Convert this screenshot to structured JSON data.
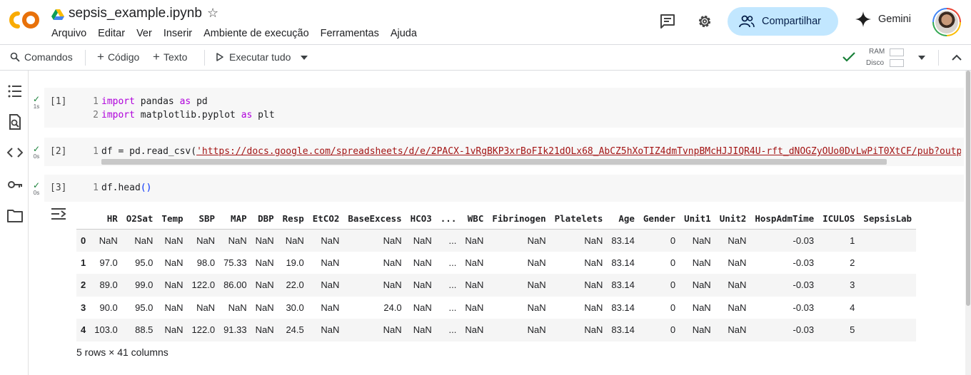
{
  "app": {
    "notebook_title": "sepsis_example.ipynb",
    "menu": [
      "Arquivo",
      "Editar",
      "Ver",
      "Inserir",
      "Ambiente de execução",
      "Ferramentas",
      "Ajuda"
    ],
    "share_label": "Compartilhar",
    "gemini_label": "Gemini"
  },
  "toolbar": {
    "commands_label": "Comandos",
    "code_label": "Código",
    "text_label": "Texto",
    "run_all_label": "Executar tudo",
    "ram_label": "RAM",
    "disk_label": "Disco"
  },
  "cells": [
    {
      "prompt": "[1]",
      "runtime": "1s",
      "lines": [
        {
          "n": "1",
          "parts": [
            [
              "kw",
              "import"
            ],
            [
              "t",
              " pandas "
            ],
            [
              "kw",
              "as"
            ],
            [
              "t",
              " pd"
            ]
          ]
        },
        {
          "n": "2",
          "parts": [
            [
              "kw",
              "import"
            ],
            [
              "t",
              " matplotlib.pyplot "
            ],
            [
              "kw",
              "as"
            ],
            [
              "t",
              " plt"
            ]
          ]
        }
      ]
    },
    {
      "prompt": "[2]",
      "runtime": "0s",
      "lines": [
        {
          "n": "1",
          "parts": [
            [
              "t",
              "df = pd.read_csv("
            ],
            [
              "str",
              "'https://docs.google.com/spreadsheets/d/e/2PACX-1vRgBKP3xrBoFIk21dOLx68_AbCZ5hXoTIZ4dmTvnpBMcHJJIQR4U-rft_dNOGZyOUo0DvLwPiT0XtCF/pub?output"
            ]
          ]
        }
      ]
    },
    {
      "prompt": "[3]",
      "runtime": "0s",
      "lines": [
        {
          "n": "1",
          "parts": [
            [
              "t",
              "df.head"
            ],
            [
              "paren",
              "()"
            ]
          ]
        }
      ]
    }
  ],
  "dataframe": {
    "columns": [
      "",
      "HR",
      "O2Sat",
      "Temp",
      "SBP",
      "MAP",
      "DBP",
      "Resp",
      "EtCO2",
      "BaseExcess",
      "HCO3",
      "...",
      "WBC",
      "Fibrinogen",
      "Platelets",
      "Age",
      "Gender",
      "Unit1",
      "Unit2",
      "HospAdmTime",
      "ICULOS",
      "SepsisLab"
    ],
    "rows": [
      [
        "0",
        "NaN",
        "NaN",
        "NaN",
        "NaN",
        "NaN",
        "NaN",
        "NaN",
        "NaN",
        "NaN",
        "NaN",
        "...",
        "NaN",
        "NaN",
        "NaN",
        "83.14",
        "0",
        "NaN",
        "NaN",
        "-0.03",
        "1",
        ""
      ],
      [
        "1",
        "97.0",
        "95.0",
        "NaN",
        "98.0",
        "75.33",
        "NaN",
        "19.0",
        "NaN",
        "NaN",
        "NaN",
        "...",
        "NaN",
        "NaN",
        "NaN",
        "83.14",
        "0",
        "NaN",
        "NaN",
        "-0.03",
        "2",
        ""
      ],
      [
        "2",
        "89.0",
        "99.0",
        "NaN",
        "122.0",
        "86.00",
        "NaN",
        "22.0",
        "NaN",
        "NaN",
        "NaN",
        "...",
        "NaN",
        "NaN",
        "NaN",
        "83.14",
        "0",
        "NaN",
        "NaN",
        "-0.03",
        "3",
        ""
      ],
      [
        "3",
        "90.0",
        "95.0",
        "NaN",
        "NaN",
        "NaN",
        "NaN",
        "30.0",
        "NaN",
        "24.0",
        "NaN",
        "...",
        "NaN",
        "NaN",
        "NaN",
        "83.14",
        "0",
        "NaN",
        "NaN",
        "-0.03",
        "4",
        ""
      ],
      [
        "4",
        "103.0",
        "88.5",
        "NaN",
        "122.0",
        "91.33",
        "NaN",
        "24.5",
        "NaN",
        "NaN",
        "NaN",
        "...",
        "NaN",
        "NaN",
        "NaN",
        "83.14",
        "0",
        "NaN",
        "NaN",
        "-0.03",
        "5",
        ""
      ]
    ],
    "footer": "5 rows × 41 columns"
  },
  "colors": {
    "share_bg": "#c2e7ff",
    "keyword": "#af00db",
    "string": "#a31515",
    "success": "#188038"
  }
}
